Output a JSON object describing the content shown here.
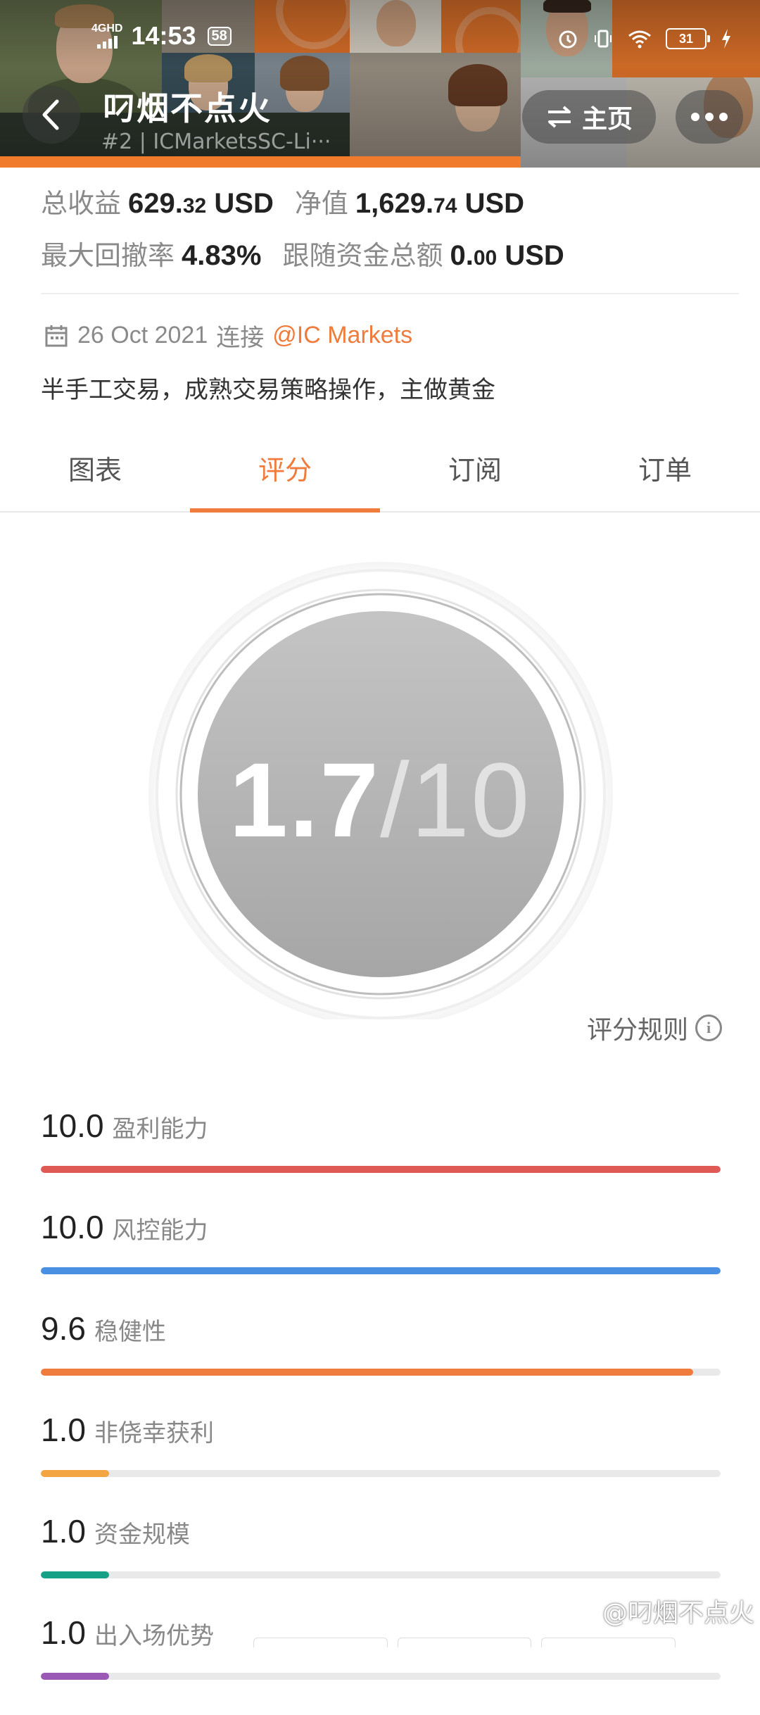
{
  "status_bar": {
    "network": "4GHD",
    "time": "14:53",
    "badge": "58",
    "battery": "31"
  },
  "header": {
    "title": "叼烟不点火",
    "subtitle": "#2 | ICMarketsSC-Li···",
    "home_label": "主页",
    "icons": {
      "back": "chevron-left-icon",
      "home": "swap-icon",
      "more": "more-dots-icon"
    }
  },
  "stats": {
    "total_profit_label": "总收益",
    "total_profit_int": "629.",
    "total_profit_dec": "32",
    "total_profit_unit": "USD",
    "equity_label": "净值",
    "equity_int": "1,629.",
    "equity_dec": "74",
    "equity_unit": "USD",
    "max_drawdown_label": "最大回撤率",
    "max_drawdown": "4.83%",
    "follow_total_label": "跟随资金总额",
    "follow_total_int": "0.",
    "follow_total_dec": "00",
    "follow_total_unit": "USD"
  },
  "meta": {
    "date": "26 Oct 2021",
    "connect_label": "连接",
    "broker": "@IC Markets"
  },
  "description": "半手工交易，成熟交易策略操作，主做黄金",
  "tabs": [
    {
      "label": "图表"
    },
    {
      "label": "评分"
    },
    {
      "label": "订阅"
    },
    {
      "label": "订单"
    }
  ],
  "active_tab": 1,
  "score": {
    "value": "1.7",
    "denominator": "/10"
  },
  "rules_label": "评分规则",
  "metrics": [
    {
      "score": "10.0",
      "name": "盈利能力",
      "fraction": 1.0,
      "color": "#e05a55"
    },
    {
      "score": "10.0",
      "name": "风控能力",
      "fraction": 1.0,
      "color": "#4a90e2"
    },
    {
      "score": "9.6",
      "name": "稳健性",
      "fraction": 0.96,
      "color": "#ef7b3c"
    },
    {
      "score": "1.0",
      "name": "非侥幸获利",
      "fraction": 0.1,
      "color": "#f2a541"
    },
    {
      "score": "1.0",
      "name": "资金规模",
      "fraction": 0.1,
      "color": "#16a085"
    },
    {
      "score": "1.0",
      "name": "出入场优势",
      "fraction": 0.1,
      "color": "#9b59b6"
    }
  ],
  "watermark": "@叼烟不点火"
}
